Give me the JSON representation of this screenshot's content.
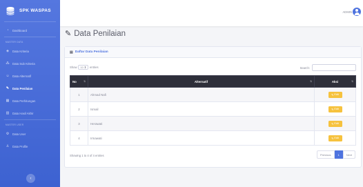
{
  "brand": {
    "name": "SPK WASPAS"
  },
  "sidebar": {
    "items": [
      {
        "label": "Dashboard",
        "icon": "gauge-icon"
      },
      {
        "heading": "MASTER DATA"
      },
      {
        "label": "Data Kriteria",
        "icon": "cube-icon"
      },
      {
        "label": "Data Sub Kriteria",
        "icon": "cubes-icon"
      },
      {
        "label": "Data Alternatif",
        "icon": "users-icon"
      },
      {
        "label": "Data Penilaian",
        "icon": "edit-icon",
        "active": true
      },
      {
        "label": "Data Perhitungan",
        "icon": "calculator-icon"
      },
      {
        "label": "Data Hasil Akhir",
        "icon": "chart-icon"
      },
      {
        "heading": "MASTER USER"
      },
      {
        "label": "Data User",
        "icon": "user-cog-icon"
      },
      {
        "label": "Data Profile",
        "icon": "user-icon"
      }
    ],
    "toggle_symbol": "‹"
  },
  "topbar": {
    "user_name": "ADMIN"
  },
  "page": {
    "title": "Data Penilaian"
  },
  "card": {
    "title": "Daftar Data Penilaian"
  },
  "datatable": {
    "show_label": "Show",
    "length_value": "10",
    "entries_label": "entries",
    "search_label": "Search:",
    "columns": {
      "no": "No",
      "alternatif": "Alternatif",
      "aksi": "Aksi"
    },
    "rows": [
      {
        "no": "1",
        "alternatif": "Ahmad Nafi",
        "action": "Edit"
      },
      {
        "no": "2",
        "alternatif": "Ismail",
        "action": "Edit"
      },
      {
        "no": "3",
        "alternatif": "Herawati",
        "action": "Edit"
      },
      {
        "no": "4",
        "alternatif": "Irmawati",
        "action": "Edit"
      }
    ],
    "info": "Showing 1 to 4 of 4 entries",
    "pagination": {
      "prev": "Previous",
      "current": "1",
      "next": "Next"
    }
  },
  "colors": {
    "sidebar": "#4e73df",
    "table_header": "#2e2f3a",
    "edit_button": "#f6c23e"
  }
}
